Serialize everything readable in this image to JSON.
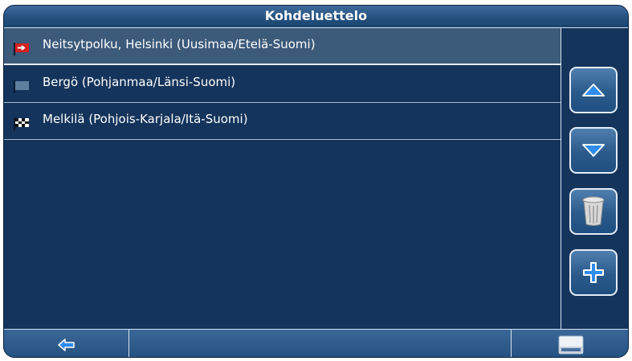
{
  "header": {
    "title": "Kohdeluettelo"
  },
  "list": {
    "items": [
      {
        "label": "Neitsytpolku, Helsinki (Uusimaa/Etelä-Suomi)",
        "icon": "start-flag-icon",
        "selected": true
      },
      {
        "label": "Bergö (Pohjanmaa/Länsi-Suomi)",
        "icon": "waypoint-flag-icon",
        "selected": false
      },
      {
        "label": "Melkilä (Pohjois-Karjala/Itä-Suomi)",
        "icon": "finish-flag-icon",
        "selected": false
      }
    ]
  },
  "sidebar": {
    "buttons": [
      {
        "icon": "arrow-up-icon"
      },
      {
        "icon": "arrow-down-icon"
      },
      {
        "icon": "trash-icon"
      },
      {
        "icon": "plus-icon"
      }
    ]
  },
  "footer": {
    "back_icon": "back-arrow-icon",
    "right_icon": "keyboard-icon"
  },
  "colors": {
    "background": "#14345b",
    "selected_row": "#3c5a7a",
    "accent_blue": "#2f8cf0",
    "start_flag": "#d92020"
  }
}
